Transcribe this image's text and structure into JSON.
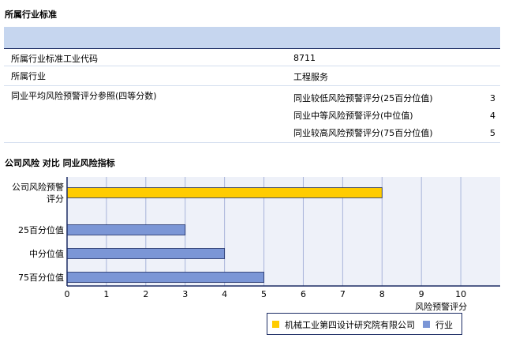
{
  "section1": {
    "title": "所属行业标准",
    "rows": [
      {
        "label": "所属行业标准工业代码",
        "value": "8711"
      },
      {
        "label": "所属行业",
        "value": "工程服务"
      }
    ],
    "benchmark": {
      "label": "同业平均风险预警评分参照(四等分数)",
      "items": [
        {
          "label": "同业较低风险预警评分(25百分位值)",
          "value": "3"
        },
        {
          "label": "同业中等风险预警评分(中位值)",
          "value": "4"
        },
        {
          "label": "同业较高风险预警评分(75百分位值)",
          "value": "5"
        }
      ]
    }
  },
  "section2": {
    "title": "公司风险 对比 同业风险指标"
  },
  "chart_data": {
    "type": "bar",
    "orientation": "horizontal",
    "categories": [
      "公司风险预警评分",
      "25百分位值",
      "中分位值",
      "75百分位值"
    ],
    "values": [
      8,
      3,
      4,
      5
    ],
    "bar_series": [
      "company",
      "industry",
      "industry",
      "industry"
    ],
    "xlabel": "风险预警评分",
    "xlim": [
      0,
      11
    ],
    "xticks": [
      0,
      1,
      2,
      3,
      4,
      5,
      6,
      7,
      8,
      9,
      10
    ],
    "grid": true,
    "legend_position": "bottom-right",
    "legend": [
      {
        "name": "机械工业第四设计研究院有限公司",
        "color": "#ffcc00"
      },
      {
        "name": "行业",
        "color": "#7b96d6"
      }
    ],
    "colors": {
      "company": "#ffcc00",
      "industry": "#7b96d6",
      "plot_bg": "#eef1f9",
      "grid": "#a8b4da"
    }
  }
}
